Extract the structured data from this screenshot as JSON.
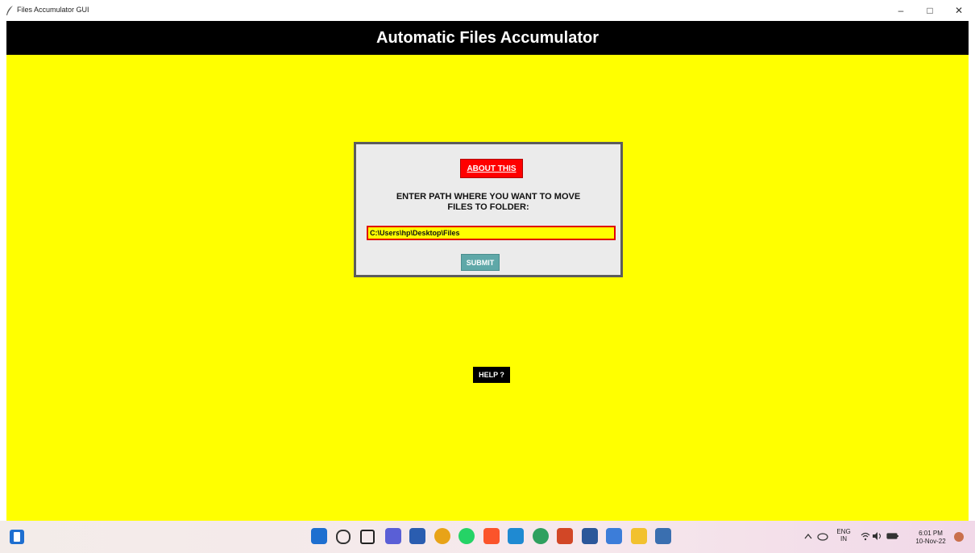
{
  "window": {
    "title": "Files Accumulator GUI",
    "controls": {
      "minimize": "–",
      "maximize": "□",
      "close": "✕"
    }
  },
  "app": {
    "header_title": "Automatic Files Accumulator",
    "about_button": "ABOUT THIS",
    "prompt_line1": "ENTER PATH WHERE YOU WANT TO MOVE",
    "prompt_line2": "FILES TO FOLDER:",
    "path_value": "C:\\Users\\hp\\Desktop\\Files",
    "submit_button": "SUBMIT",
    "help_button": "HELP ?"
  },
  "colors": {
    "background": "#ffff00",
    "header": "#000000",
    "about_button": "#ff0000",
    "submit_button": "#5fa8a8",
    "panel": "#ebebeb"
  },
  "taskbar": {
    "widgets_icon": "widgets-icon",
    "apps": [
      {
        "name": "start-icon",
        "color": "#1e6fd0"
      },
      {
        "name": "search-icon",
        "color": "#333333"
      },
      {
        "name": "task-view-icon",
        "color": "#222222"
      },
      {
        "name": "chat-icon",
        "color": "#5a5fd6"
      },
      {
        "name": "store-icon",
        "color": "#2a5db0"
      },
      {
        "name": "chrome-icon",
        "color": "#e8a317"
      },
      {
        "name": "whatsapp-icon",
        "color": "#25d366"
      },
      {
        "name": "brave-icon",
        "color": "#fb542b"
      },
      {
        "name": "vscode-icon",
        "color": "#1f8ad2"
      },
      {
        "name": "edge-icon",
        "color": "#2fa05f"
      },
      {
        "name": "powerpoint-icon",
        "color": "#d24726"
      },
      {
        "name": "word-icon",
        "color": "#2b579a"
      },
      {
        "name": "notepad-icon",
        "color": "#3c7dd9"
      },
      {
        "name": "file-explorer-icon",
        "color": "#f2c12e"
      },
      {
        "name": "python-app-icon",
        "color": "#3a6fb0"
      }
    ],
    "tray": {
      "chevron": "^",
      "language_top": "ENG",
      "language_bottom": "IN",
      "time": "6:01 PM",
      "date": "10-Nov-22"
    }
  }
}
